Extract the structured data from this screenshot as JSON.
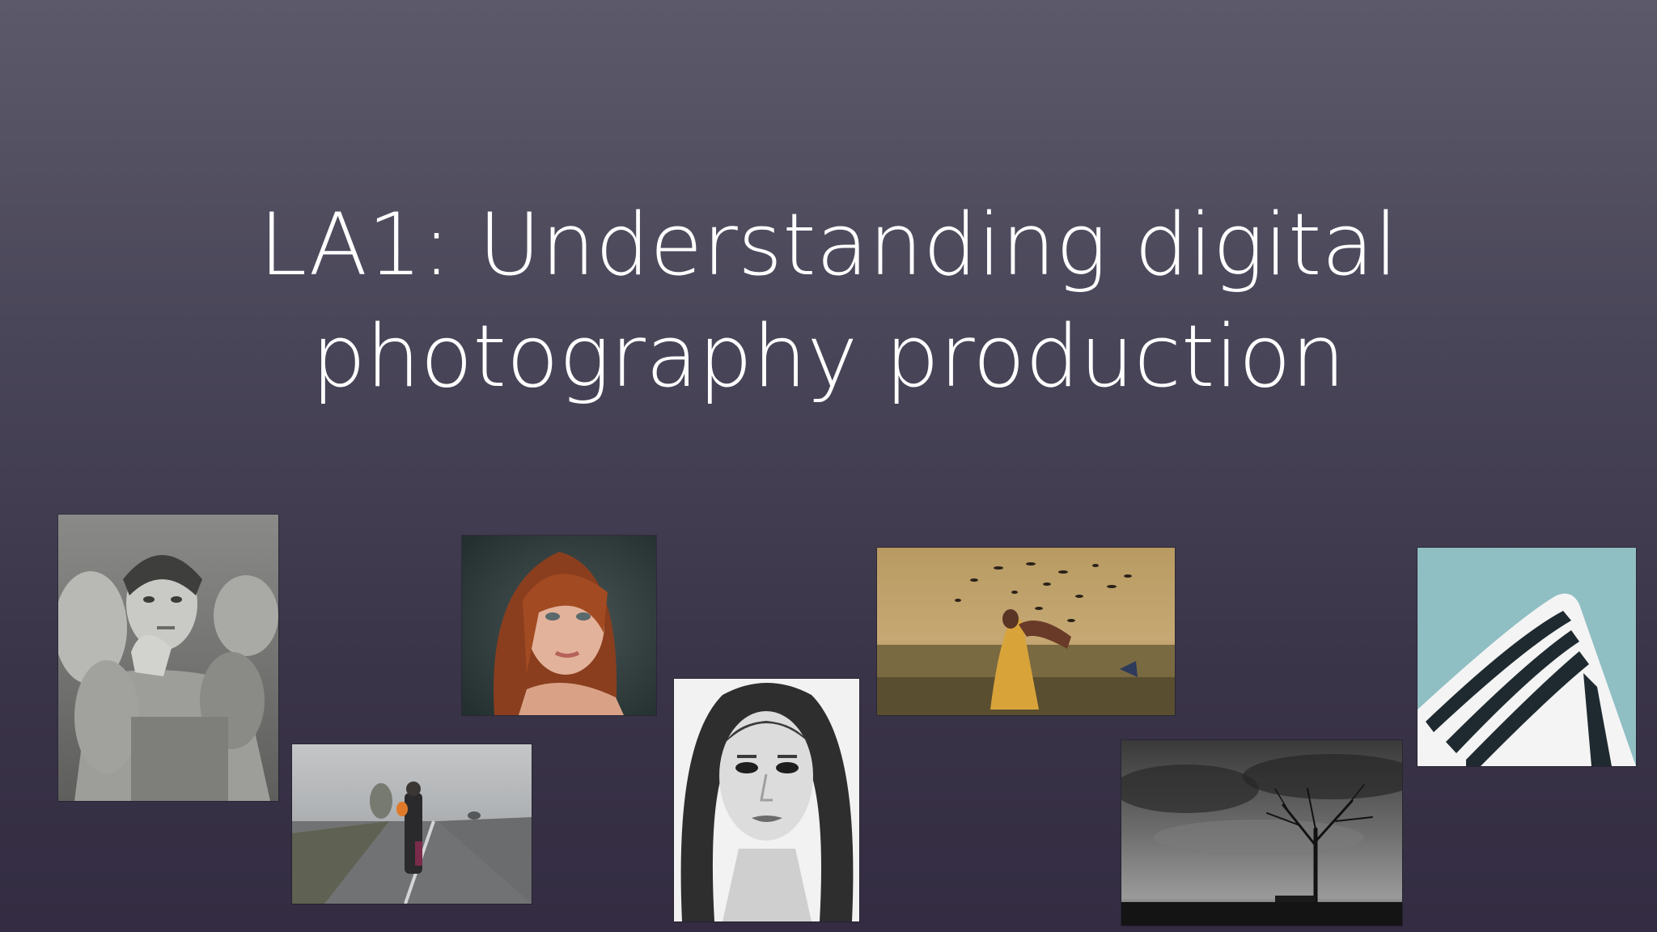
{
  "slide": {
    "title_line1": "LA1: Understanding digital",
    "title_line2": "photography production"
  },
  "colors": {
    "background_top": "#5c5a6a",
    "background_bottom": "#332c42",
    "title_text": "#ffffff"
  },
  "photos": [
    {
      "subject": "black-and-white documentary portrait of a mother with children"
    },
    {
      "subject": "figure carrying a child walking along a rainy road"
    },
    {
      "subject": "color portrait of a red-haired woman"
    },
    {
      "subject": "black-and-white fashion portrait of a woman's face"
    },
    {
      "subject": "surreal photo of a figure in a yellow dress in a field with flying birds"
    },
    {
      "subject": "black-and-white landscape of a lone bare tree under stormy sky"
    },
    {
      "subject": "abstract architecture of a curved striped building against teal sky"
    }
  ]
}
